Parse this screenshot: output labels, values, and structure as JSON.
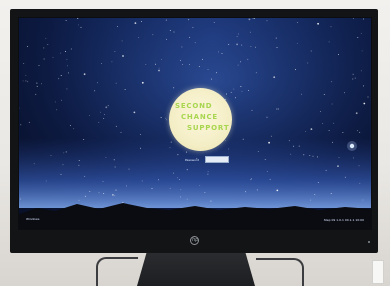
{
  "logo": {
    "line1": "SECOND",
    "line2": "CHANCE",
    "line3": "SUPPORT"
  },
  "login": {
    "label": "Password",
    "value": ""
  },
  "screen_footer": {
    "brand": "Windows",
    "status": "Step 09 1.0.1 00.1.1 10:00"
  },
  "monitor": {
    "logo_text": "hp"
  },
  "colors": {
    "sky_top": "#1e3a80",
    "sky_bottom": "#080f26",
    "logo_circle": "#f4eec6",
    "logo_text": "#a8d64e",
    "bezel": "#121416"
  }
}
